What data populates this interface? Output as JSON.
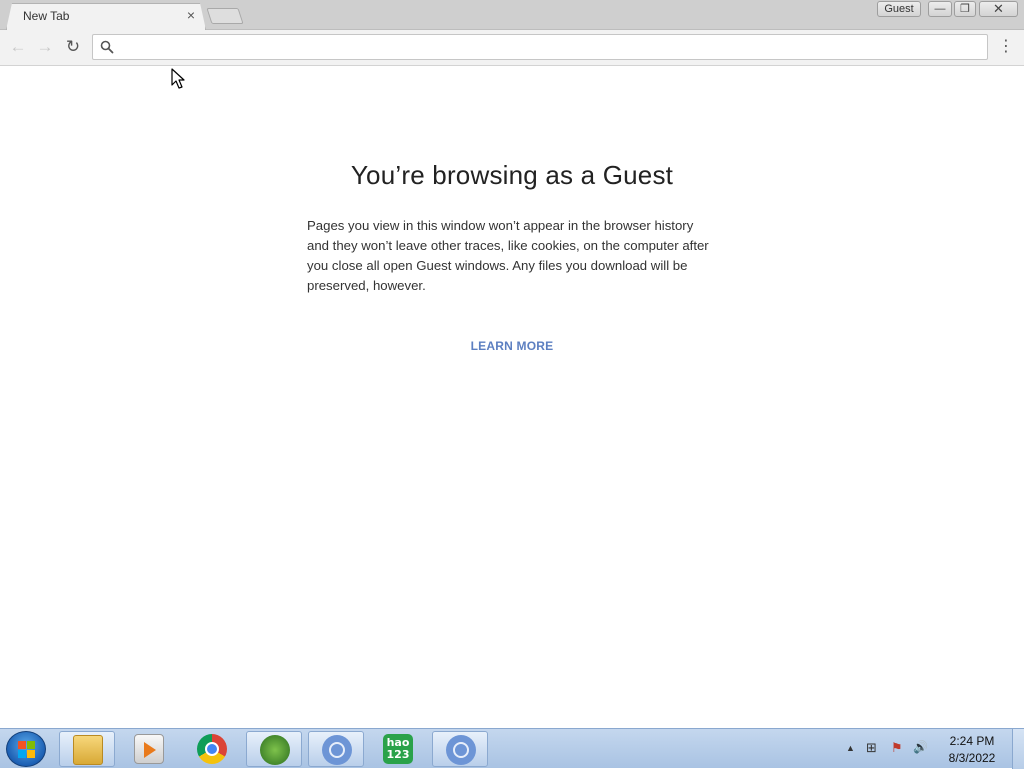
{
  "tab": {
    "title": "New Tab",
    "close_glyph": "×"
  },
  "window": {
    "profile_badge": "Guest",
    "minimize_glyph": "—",
    "maximize_glyph": "❐",
    "close_glyph": "✕"
  },
  "toolbar": {
    "back_glyph": "←",
    "forward_glyph": "→",
    "reload_glyph": "↻",
    "menu_glyph": "⋮",
    "omnibox_value": "",
    "omnibox_placeholder": ""
  },
  "page": {
    "title": "You’re browsing as a Guest",
    "description": "Pages you view in this window won’t appear in the browser history and they won’t leave other traces, like cookies, on the computer after you close all open Guest windows. Any files you download will be preserved, however.",
    "learn_more": "LEARN MORE",
    "link_color": "#5c7fc1"
  },
  "taskbar": {
    "items": [
      {
        "name": "file-explorer",
        "icon": "folder-icon"
      },
      {
        "name": "media-player",
        "icon": "media-icon"
      },
      {
        "name": "chrome",
        "icon": "chrome-icon"
      },
      {
        "name": "windows-app",
        "icon": "windows-icon"
      },
      {
        "name": "chrome-guest-1",
        "icon": "chrome-blue-icon"
      },
      {
        "name": "hao123",
        "icon": "hao123-icon",
        "label": "hao 123"
      },
      {
        "name": "chrome-guest-2",
        "icon": "chrome-blue-icon"
      }
    ],
    "tray": {
      "up_arrow": "▲",
      "network_glyph": "⊞",
      "flag_glyph": "⚑",
      "volume_glyph": "🔊"
    },
    "clock": {
      "time": "2:24 PM",
      "date": "8/3/2022"
    }
  }
}
